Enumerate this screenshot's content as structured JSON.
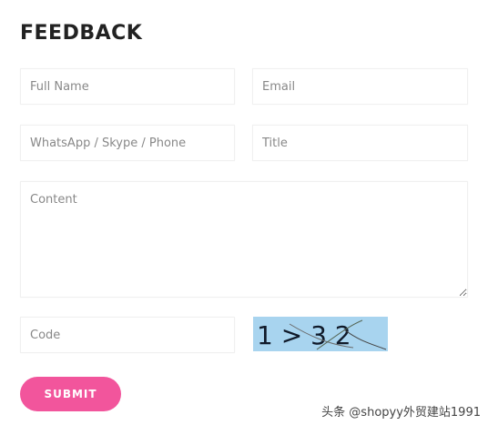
{
  "form": {
    "title": "FEEDBACK",
    "full_name_placeholder": "Full Name",
    "email_placeholder": "Email",
    "contact_placeholder": "WhatsApp / Skype / Phone",
    "title_placeholder": "Title",
    "content_placeholder": "Content",
    "code_placeholder": "Code",
    "submit_label": "SUBMIT"
  },
  "captcha": {
    "text": "1 > 3 2"
  },
  "watermark": "头条 @shopyy外贸建站1991",
  "colors": {
    "accent": "#f2559c",
    "captcha_bg": "#a8d4ef"
  }
}
